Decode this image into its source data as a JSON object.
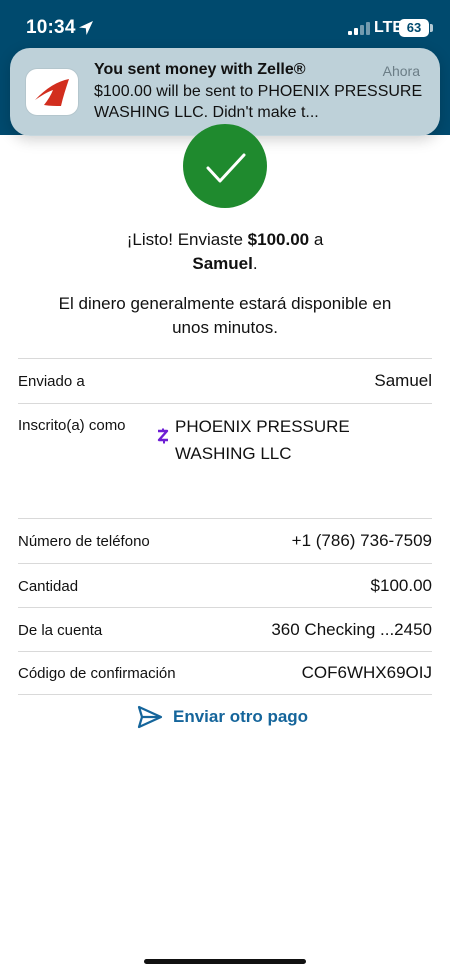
{
  "status_bar": {
    "time": "10:34",
    "network": "LTE",
    "battery": "63"
  },
  "notification": {
    "title": "You sent money with Zelle®",
    "time": "Ahora",
    "body": "$100.00 will be sent to PHOENIX PRESSURE WASHING LLC. Didn't make t..."
  },
  "confirmation": {
    "prefix": "¡Listo! Enviaste ",
    "amount": "$100.00",
    "middle": " a",
    "recipient": "Samuel",
    "suffix": ".",
    "availability": "El dinero generalmente estará disponible en unos minutos."
  },
  "details": {
    "rows": [
      {
        "label": "Enviado a",
        "value": "Samuel"
      },
      {
        "label": "Inscrito(a) como",
        "value": "PHOENIX PRESSURE WASHING LLC"
      },
      {
        "label": "Número de teléfono",
        "value": "+1 (786) 736-7509"
      },
      {
        "label": "Cantidad",
        "value": "$100.00"
      },
      {
        "label": "De la cuenta",
        "value": "360 Checking ...2450"
      },
      {
        "label": "Código de confirmación",
        "value": "COF6WHX69OIJ"
      }
    ]
  },
  "actions": {
    "send_another": "Enviar otro pago"
  },
  "colors": {
    "header_blue": "#004a6e",
    "success_green": "#1f8a2e",
    "link_blue": "#15659b",
    "zelle_purple": "#6d1ed4"
  },
  "icons": {
    "location": "location-arrow-icon",
    "signal": "cellular-signal-icon",
    "app": "capital-one-app-icon",
    "success": "checkmark-icon",
    "zelle": "zelle-icon",
    "send": "paper-plane-icon"
  }
}
